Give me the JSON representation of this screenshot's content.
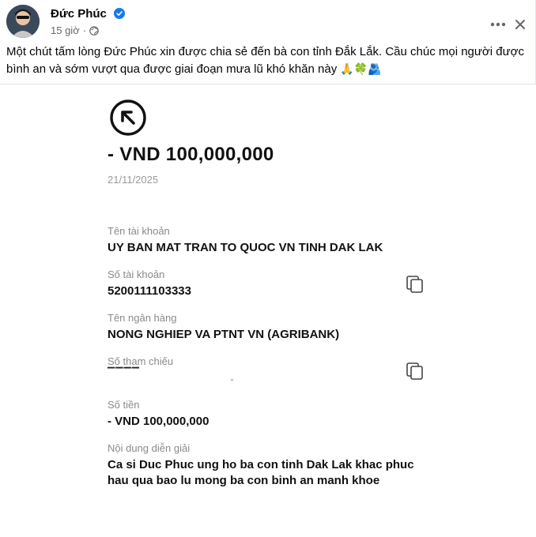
{
  "post": {
    "author": "Đức Phúc",
    "time": "15 giờ",
    "caption": "Một chút tấm lòng Đức Phúc xin được chia sẻ đến bà con tỉnh Đắk Lắk.  Cầu chúc mọi người được bình an và sớm vượt qua được giai đoạn mưa lũ khó khăn này",
    "caption_emojis": "🙏🍀🫂",
    "icons": [
      "verified-badge-icon",
      "globe-icon",
      "more-options-icon",
      "close-icon",
      "avatar"
    ],
    "colors": {
      "accent": "#1877f2",
      "secondary_text": "#65676b",
      "divider": "#e4e6eb"
    }
  },
  "receipt": {
    "direction_icon": "arrow-up-left-icon",
    "amount": "- VND 100,000,000",
    "date": "21/11/2025",
    "fields": [
      {
        "label": "Tên tài khoản",
        "value": "UY BAN MAT TRAN TO QUOC VN TINH DAK LAK"
      },
      {
        "label": "Số tài khoản",
        "value": "5200111103333"
      },
      {
        "label": "Tên ngân hàng",
        "value": "NONG NGHIEP VA PTNT VN (AGRIBANK)"
      },
      {
        "label": "Số tham chiếu",
        "value": "▔▔▔▔"
      },
      {
        "label": "Số tiền",
        "value": "- VND 100,000,000"
      },
      {
        "label": "Nội dung diễn giải",
        "value_line1": "Ca si Duc Phuc ung ho ba con tinh Dak Lak khac phuc",
        "value_line2": "hau qua bao lu mong ba con binh an manh khoe"
      }
    ]
  }
}
